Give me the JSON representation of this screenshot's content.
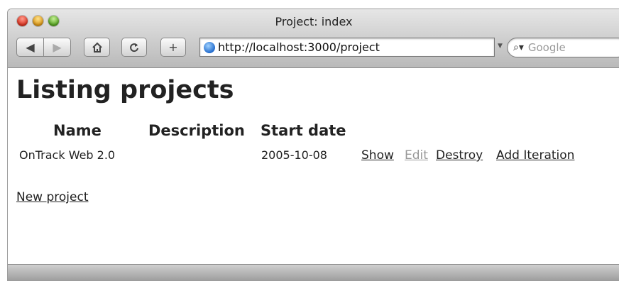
{
  "window": {
    "title": "Project: index"
  },
  "toolbar": {
    "back_icon": "back-arrow-icon",
    "forward_icon": "forward-arrow-icon",
    "home_icon": "home-icon",
    "reload_icon": "reload-icon",
    "add_icon": "plus-icon",
    "url": "http://localhost:3000/project",
    "search_placeholder": "Google"
  },
  "page": {
    "heading": "Listing projects",
    "columns": [
      "Name",
      "Description",
      "Start date"
    ],
    "rows": [
      {
        "name": "OnTrack Web 2.0",
        "description": "",
        "start_date": "2005-10-08",
        "actions": [
          "Show",
          "Edit",
          "Destroy",
          "Add Iteration"
        ]
      }
    ],
    "new_link": "New project"
  }
}
